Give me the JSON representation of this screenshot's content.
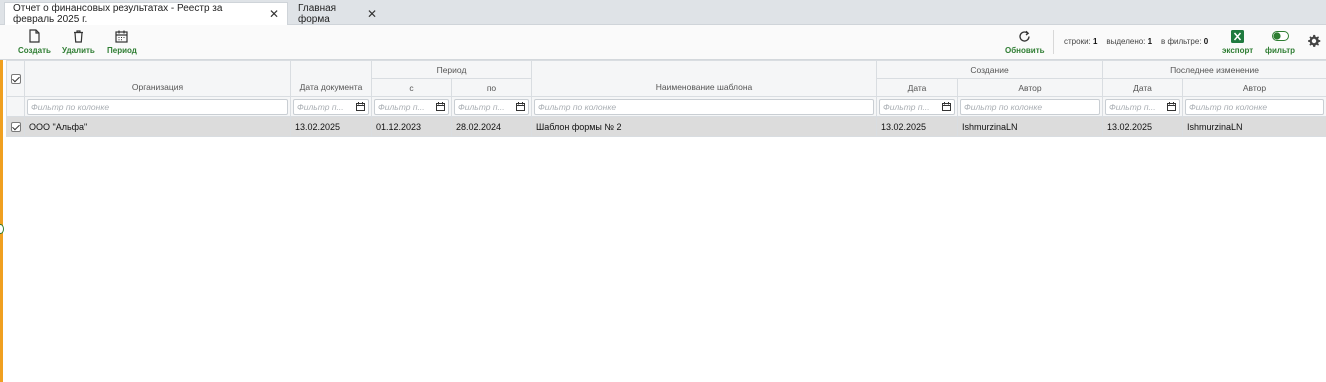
{
  "tabs": [
    {
      "label": "Отчет о финансовых результатах - Реестр за февраль 2025 г.",
      "close": "✕"
    },
    {
      "label": "Главная форма",
      "close": "✕"
    }
  ],
  "toolbar": {
    "create": "Создать",
    "delete": "Удалить",
    "period": "Период",
    "refresh": "Обновить",
    "export": "экспорт",
    "filter": "фильтр"
  },
  "stats": {
    "rows_label": "строки:",
    "rows_value": "1",
    "selected_label": "выделено:",
    "selected_value": "1",
    "filtered_label": "в фильтре:",
    "filtered_value": "0"
  },
  "headers": {
    "organization": "Организация",
    "doc_date": "Дата документа",
    "period": "Период",
    "period_from": "с",
    "period_to": "по",
    "template": "Наименование шаблона",
    "created": "Создание",
    "created_date": "Дата",
    "created_author": "Автор",
    "modified": "Последнее изменение",
    "modified_date": "Дата",
    "modified_author": "Автор"
  },
  "filters": {
    "column_placeholder": "Фильтр по колонке",
    "date_placeholder": "Фильтр п..."
  },
  "rows": [
    {
      "organization": "ООО \"Альфа\"",
      "doc_date": "13.02.2025",
      "period_from": "01.12.2023",
      "period_to": "28.02.2024",
      "template": "Шаблон формы № 2",
      "created_date": "13.02.2025",
      "created_author": "IshmurzinaLN",
      "modified_date": "13.02.2025",
      "modified_author": "IshmurzinaLN"
    }
  ],
  "colors": {
    "accent_green": "#2e7d32",
    "left_accent": "#f0a020",
    "excel_green": "#1f7a3f"
  }
}
